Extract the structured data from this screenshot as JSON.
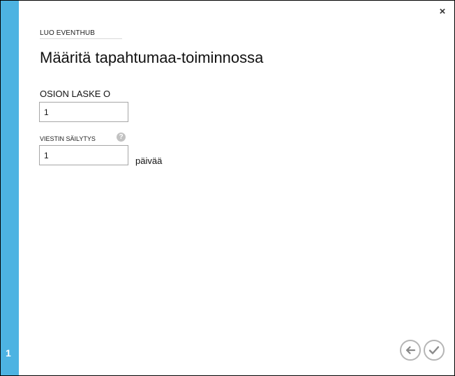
{
  "dialog": {
    "close_label": "×",
    "wizard_name": "LUO EVENTHUB",
    "title": "Määritä tapahtumaa-toiminnossa",
    "step_number": "1"
  },
  "form": {
    "partition_count": {
      "label": "OSION LASKE O",
      "value": "1"
    },
    "message_retention": {
      "label": "VIESTIN SÄILYTYS",
      "value": "1",
      "unit": "päivää",
      "help_icon": "?"
    }
  },
  "navigation": {
    "back_icon": "arrow-left-icon",
    "confirm_icon": "checkmark-icon"
  },
  "colors": {
    "step_rail": "#4db3e2",
    "button_border": "#b5b5b5"
  }
}
